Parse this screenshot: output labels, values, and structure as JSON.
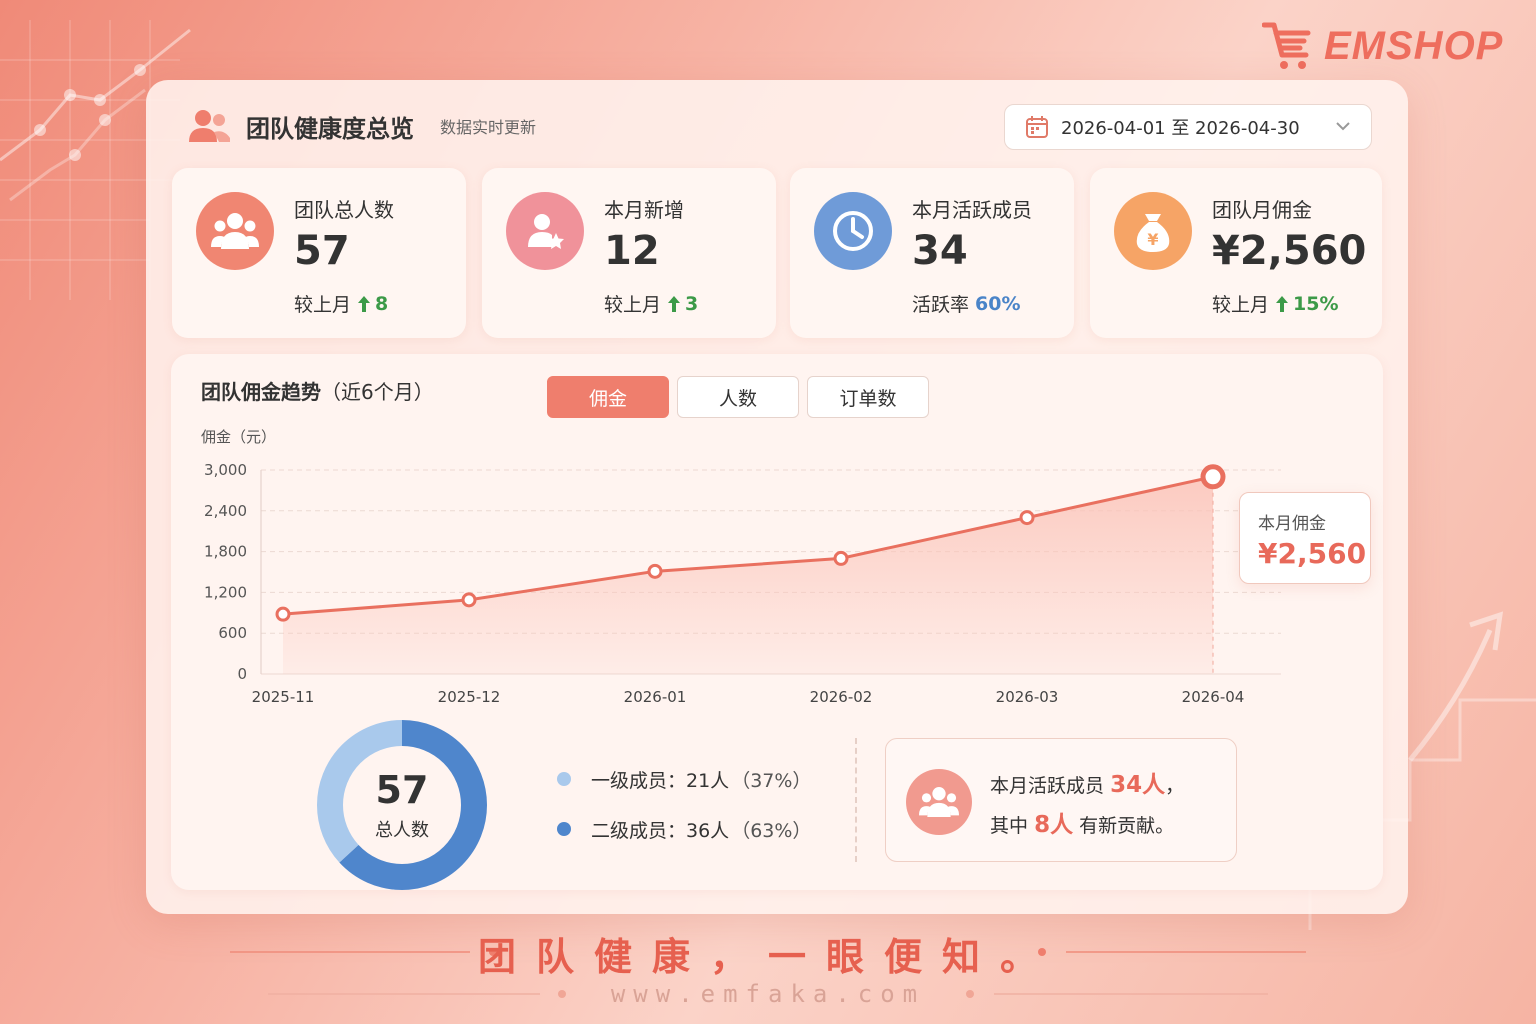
{
  "brand": {
    "name": "EMSHOP"
  },
  "header": {
    "title": "团队健康度总览",
    "subtitle": "数据实时更新",
    "date_range": "2026-04-01 至 2026-04-30"
  },
  "stats": [
    {
      "label": "团队总人数",
      "value": "57",
      "compare_label": "较上月",
      "compare_value": "8",
      "icon": "team-icon"
    },
    {
      "label": "本月新增",
      "value": "12",
      "compare_label": "较上月",
      "compare_value": "3",
      "icon": "user-star-icon"
    },
    {
      "label": "本月活跃成员",
      "value": "34",
      "compare_label": "活跃率",
      "compare_value": "60%",
      "icon": "clock-icon"
    },
    {
      "label": "团队月佣金",
      "value": "¥2,560",
      "compare_label": "较上月",
      "compare_value": "15%",
      "icon": "money-bag-icon"
    }
  ],
  "chart": {
    "title": "团队佣金趋势",
    "title_suffix": "（近6个月）",
    "tabs": [
      "佣金",
      "人数",
      "订单数"
    ],
    "active_tab": 0,
    "tooltip": {
      "label": "本月佣金",
      "value": "¥2,560"
    }
  },
  "chart_data": {
    "type": "area",
    "title": "团队佣金趋势（近6个月）",
    "ylabel": "佣金（元）",
    "xlabel": "",
    "x": [
      "2025-11",
      "2025-12",
      "2026-01",
      "2026-02",
      "2026-03",
      "2026-04"
    ],
    "values": [
      880,
      1090,
      1510,
      1700,
      2300,
      2900
    ],
    "ylim": [
      0,
      3000
    ],
    "yticks": [
      0,
      600,
      1200,
      1800,
      2400,
      3000
    ],
    "ytick_labels": [
      "0",
      "600",
      "1,200",
      "1,800",
      "2,400",
      "3,000"
    ],
    "grid": true,
    "colors": {
      "line": "#e9705f",
      "fill": "#fbc3b8"
    }
  },
  "members": {
    "total": "57",
    "total_label": "总人数",
    "levels": [
      {
        "name": "一级成员",
        "text": "一级成员：21人",
        "pct_text": "（37%）",
        "count": 21,
        "color": "#a9c9ec"
      },
      {
        "name": "二级成员",
        "text": "二级成员：36人",
        "pct_text": "（63%）",
        "count": 36,
        "color": "#4f86cc"
      }
    ]
  },
  "info": {
    "line1_prefix": "本月活跃成员",
    "line1_highlight": "34人",
    "line1_suffix": "，",
    "line2_prefix": "其中",
    "line2_highlight": "8人",
    "line2_suffix": "有新贡献。"
  },
  "footer": {
    "slogan": "团队健康，一眼便知。",
    "url": "www.emfaka.com"
  },
  "colors": {
    "accent": "#ef7e6d",
    "up": "#3c9a48",
    "blue": "#4a84c8"
  }
}
